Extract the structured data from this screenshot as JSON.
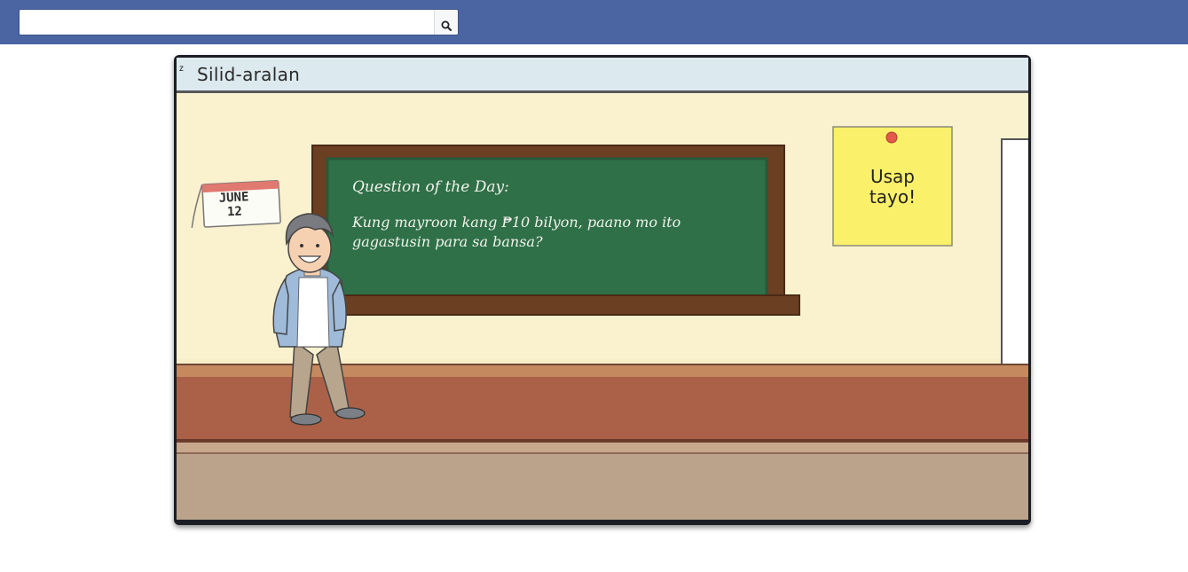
{
  "search": {
    "value": "",
    "placeholder": "",
    "button_icon": "search-icon"
  },
  "game": {
    "corner_label": "z",
    "title": "Silid-aralan",
    "chalkboard": {
      "heading": "Question of the Day:",
      "question": "Kung mayroon kang ₱10 bilyon, paano mo ito gagastusin para sa bansa?"
    },
    "calendar": {
      "month": "JUNE",
      "day": "12"
    },
    "sticky_note": {
      "line1": "Usap",
      "line2": "tayo!"
    }
  },
  "colors": {
    "topbar": "#4b65a3",
    "wall": "#f8eec7",
    "chalkboard": "#2f7049",
    "board_frame": "#6b3f22",
    "floor_wood": "#aa6148",
    "sticky_note": "#fbf06a",
    "header_strip": "#dce9ee"
  }
}
